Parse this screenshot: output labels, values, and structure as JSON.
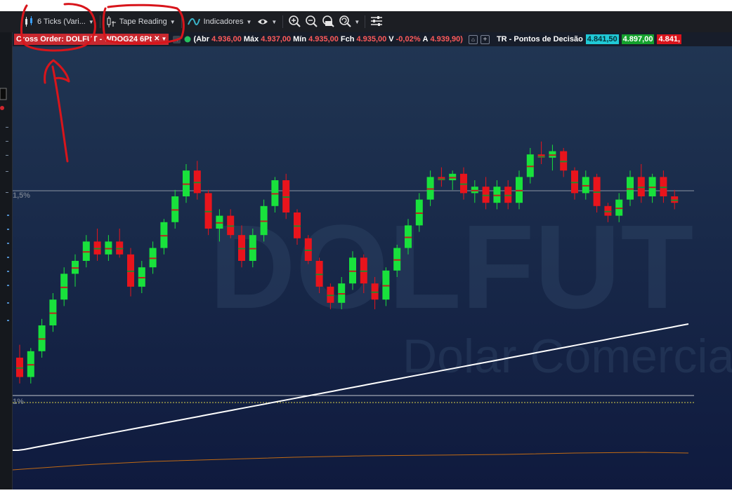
{
  "toolbar": {
    "period_label": "6 Ticks (Vari...",
    "chart_type_label": "Tape Reading",
    "indicators_label": "Indicadores"
  },
  "infobar": {
    "cross_order_label": "Cross Order: DOLFUT - WDOG24 6Pt",
    "quote_prefix": "(Abr",
    "open_value": "4.936,00",
    "max_label": "Máx",
    "max_value": "4.937,00",
    "min_label": "Mín",
    "min_value": "4.935,00",
    "close_label": "Fch",
    "close_value": "4.935,00",
    "var_label": "V",
    "var_value": "-0,02%",
    "a_label": "A",
    "a_value": "4.939,90)",
    "study_label": "TR - Pontos de Decisão",
    "level1": "4.841,50",
    "level2": "4.897,00",
    "level3": "4.841,"
  },
  "watermark": {
    "symbol": "DOLFUT",
    "name": "Dolar Comercial"
  },
  "axis_labels": {
    "upper_pct": "1,5%",
    "lower_pct": "1%"
  },
  "colors": {
    "toolbar_bg": "#1c1e23",
    "chart_top": "#203552",
    "chart_bottom": "#0f1a3e",
    "bull": "#19e13c",
    "bear": "#e8141c",
    "annotation": "#d8151b"
  },
  "icons": {
    "period": "candle-period-icon",
    "chart_type": "candlestick-icon",
    "indicators": "indicator-wave-icon",
    "visibility": "eye-icon",
    "zoom_in": "zoom-in-icon",
    "zoom_out": "zoom-out-icon",
    "settings": "sliders-icon"
  },
  "chart_data": {
    "type": "candlestick",
    "ohlc": [
      [
        20,
        28,
        4,
        8
      ],
      [
        8,
        26,
        4,
        24
      ],
      [
        24,
        44,
        20,
        40
      ],
      [
        40,
        60,
        36,
        56
      ],
      [
        56,
        76,
        52,
        72
      ],
      [
        72,
        84,
        64,
        80
      ],
      [
        80,
        96,
        76,
        92
      ],
      [
        92,
        100,
        80,
        84
      ],
      [
        84,
        96,
        80,
        92
      ],
      [
        92,
        100,
        82,
        84
      ],
      [
        84,
        88,
        58,
        64
      ],
      [
        64,
        80,
        60,
        76
      ],
      [
        76,
        92,
        72,
        88
      ],
      [
        88,
        106,
        84,
        104
      ],
      [
        104,
        124,
        100,
        120
      ],
      [
        120,
        140,
        116,
        136
      ],
      [
        136,
        142,
        118,
        122
      ],
      [
        122,
        124,
        96,
        100
      ],
      [
        100,
        112,
        92,
        108
      ],
      [
        108,
        112,
        94,
        96
      ],
      [
        96,
        102,
        76,
        80
      ],
      [
        80,
        100,
        76,
        96
      ],
      [
        96,
        118,
        92,
        114
      ],
      [
        114,
        132,
        110,
        130
      ],
      [
        130,
        134,
        106,
        110
      ],
      [
        110,
        112,
        90,
        94
      ],
      [
        94,
        96,
        78,
        80
      ],
      [
        80,
        82,
        60,
        64
      ],
      [
        64,
        66,
        50,
        54
      ],
      [
        54,
        70,
        50,
        66
      ],
      [
        66,
        86,
        62,
        82
      ],
      [
        82,
        84,
        60,
        66
      ],
      [
        66,
        70,
        50,
        56
      ],
      [
        56,
        76,
        52,
        74
      ],
      [
        74,
        90,
        70,
        88
      ],
      [
        88,
        106,
        84,
        102
      ],
      [
        102,
        122,
        98,
        118
      ],
      [
        118,
        136,
        114,
        132
      ],
      [
        132,
        138,
        126,
        130
      ],
      [
        130,
        136,
        124,
        134
      ],
      [
        134,
        138,
        118,
        122
      ],
      [
        122,
        130,
        116,
        126
      ],
      [
        126,
        132,
        112,
        116
      ],
      [
        116,
        130,
        112,
        126
      ],
      [
        126,
        130,
        112,
        116
      ],
      [
        116,
        136,
        112,
        132
      ],
      [
        132,
        150,
        128,
        146
      ],
      [
        146,
        154,
        140,
        144
      ],
      [
        144,
        152,
        136,
        148
      ],
      [
        148,
        150,
        132,
        136
      ],
      [
        136,
        138,
        118,
        122
      ],
      [
        122,
        136,
        118,
        132
      ],
      [
        132,
        134,
        110,
        114
      ],
      [
        114,
        116,
        104,
        108
      ],
      [
        108,
        122,
        104,
        118
      ],
      [
        118,
        136,
        114,
        132
      ],
      [
        132,
        140,
        116,
        120
      ],
      [
        120,
        134,
        116,
        132
      ],
      [
        132,
        136,
        116,
        120
      ],
      [
        120,
        124,
        112,
        116
      ]
    ],
    "cumulative_line": [],
    "reference_lines": [
      "1,5%",
      "1%"
    ]
  }
}
